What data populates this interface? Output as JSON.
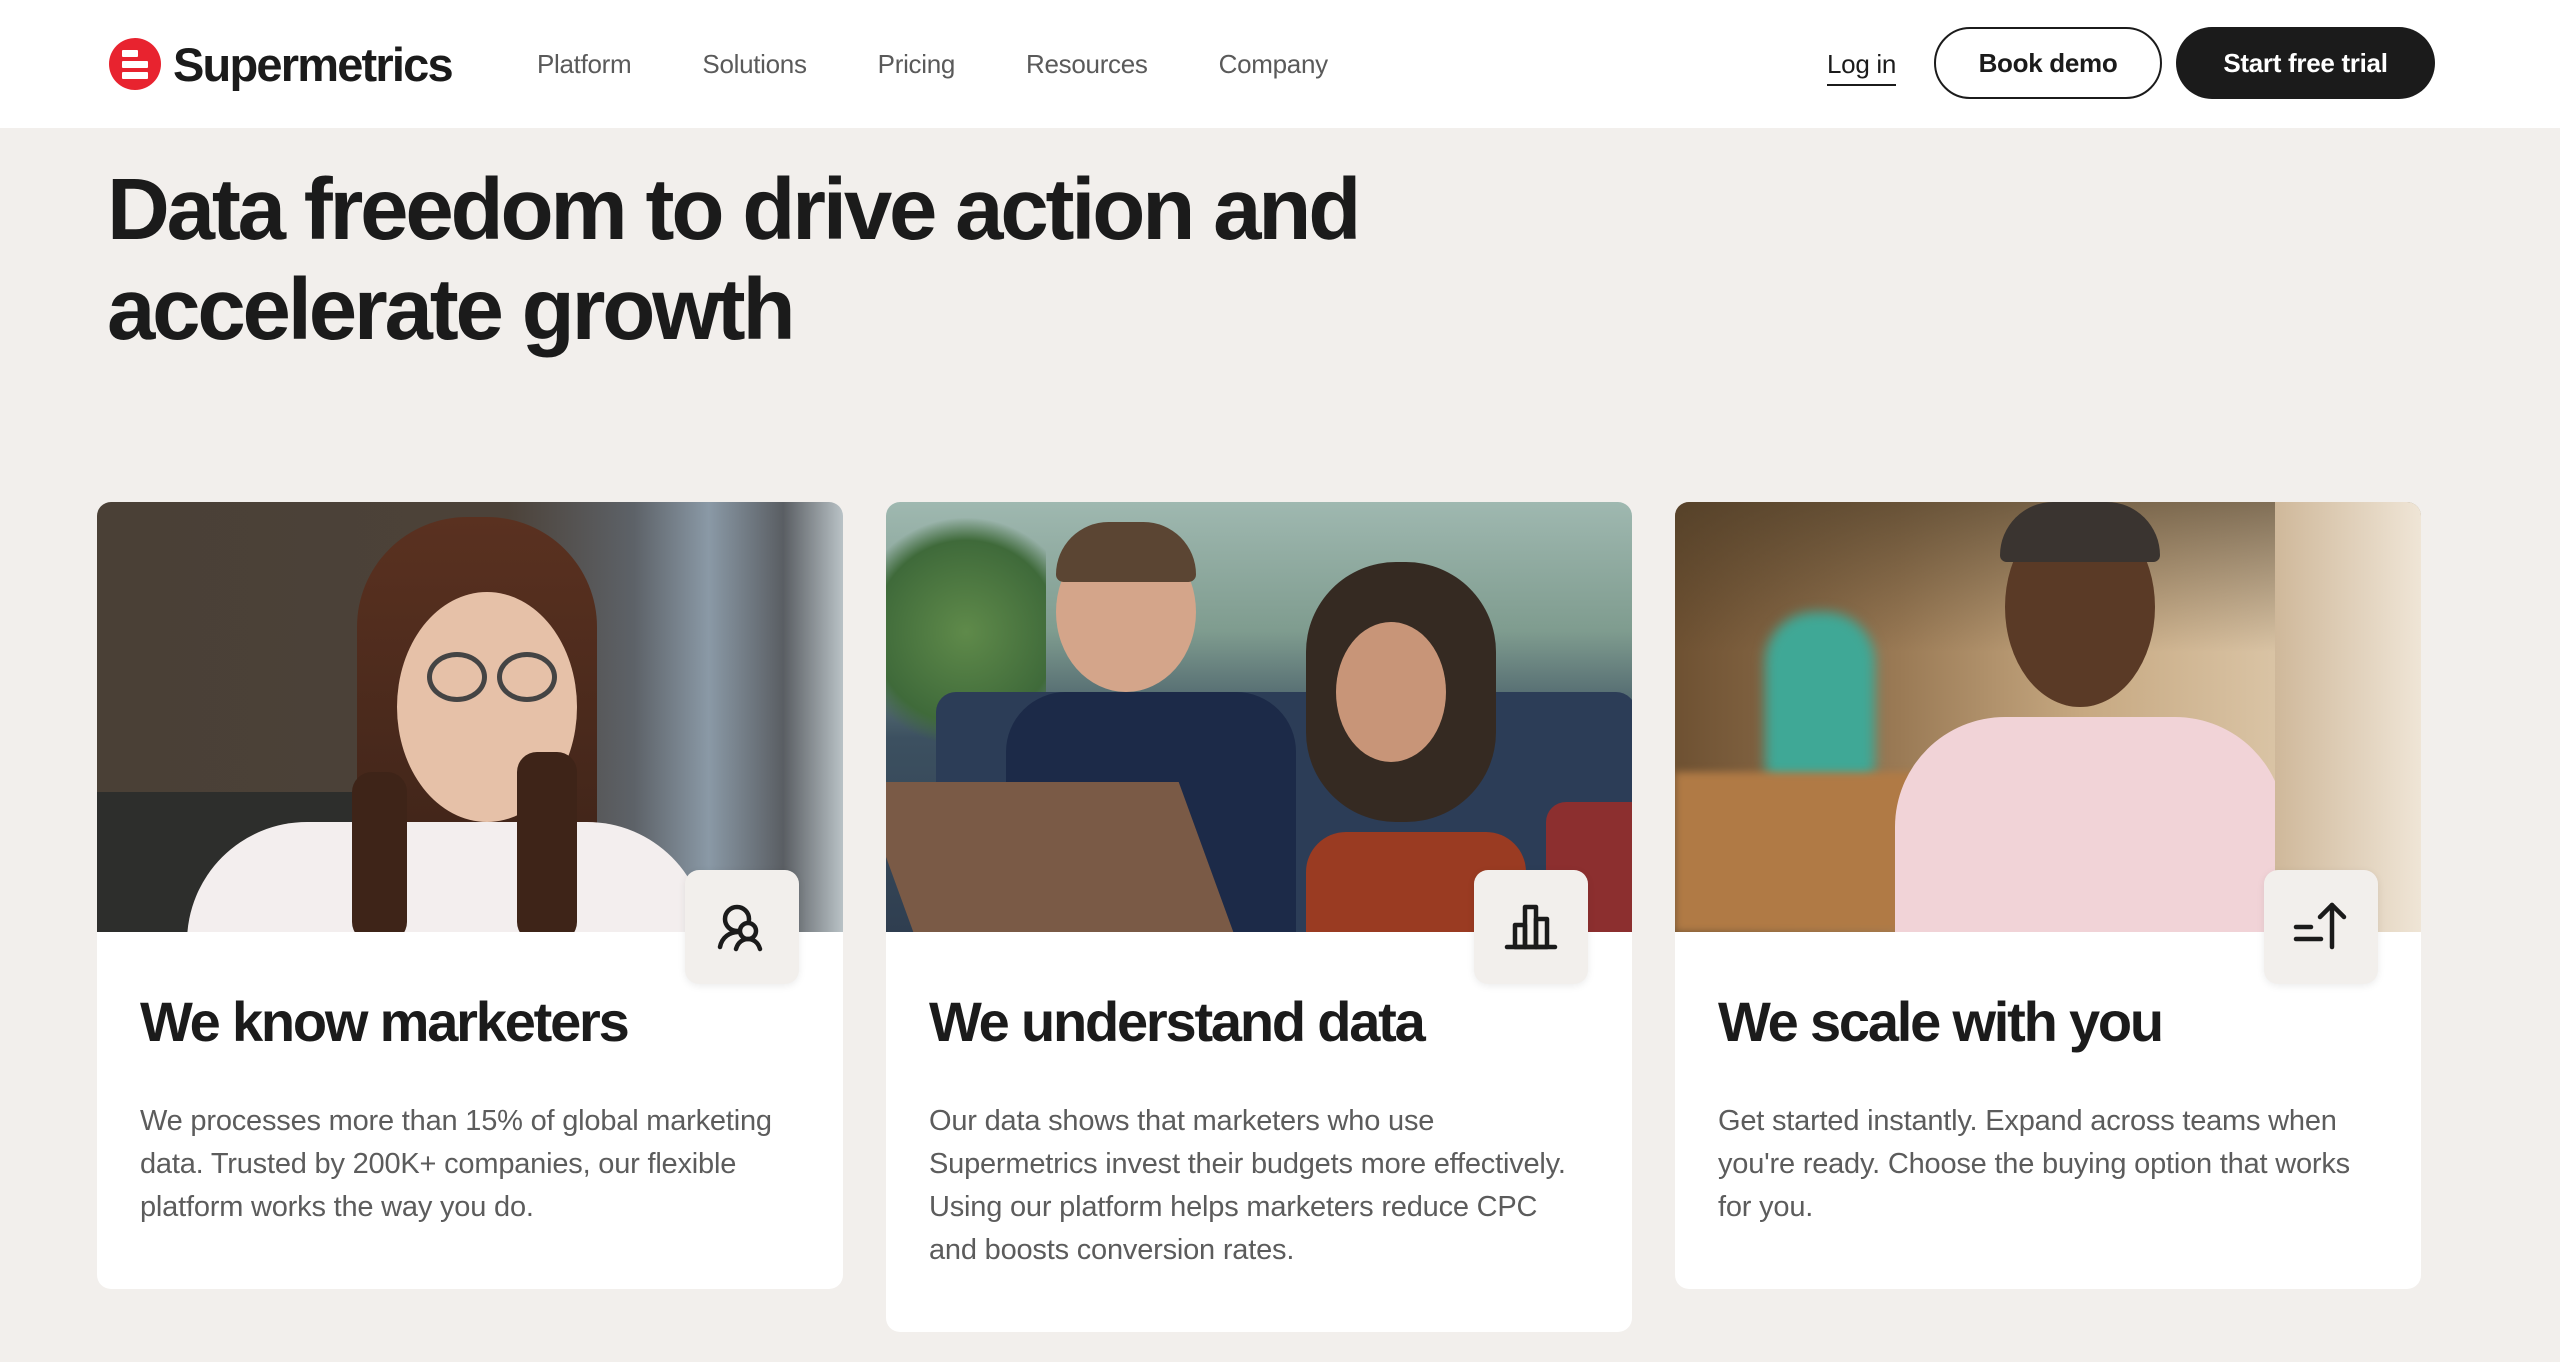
{
  "brand": {
    "name": "Supermetrics",
    "accent_color": "#e8232f"
  },
  "nav": {
    "items": [
      {
        "label": "Platform"
      },
      {
        "label": "Solutions"
      },
      {
        "label": "Pricing"
      },
      {
        "label": "Resources"
      },
      {
        "label": "Company"
      }
    ],
    "login_label": "Log in",
    "book_demo_label": "Book demo",
    "start_trial_label": "Start free trial"
  },
  "hero": {
    "title": "Data freedom to drive action and accelerate growth"
  },
  "cards": [
    {
      "title": "We know marketers",
      "text": "We processes more than 15% of global marketing data. Trusted by 200K+ companies, our flexible platform works the way you do.",
      "icon": "users-icon",
      "photo": "smiling-woman-with-glasses"
    },
    {
      "title": "We understand data",
      "text": "Our data shows that marketers who use Supermetrics invest their budgets more effectively. Using our platform helps marketers reduce CPC and boosts conversion rates.",
      "icon": "bar-chart-icon",
      "photo": "two-people-at-laptop"
    },
    {
      "title": "We scale with you",
      "text": "Get started instantly. Expand across teams when you're ready. Choose the buying option that works for you.",
      "icon": "sort-ascending-icon",
      "photo": "smiling-man-in-office"
    }
  ]
}
